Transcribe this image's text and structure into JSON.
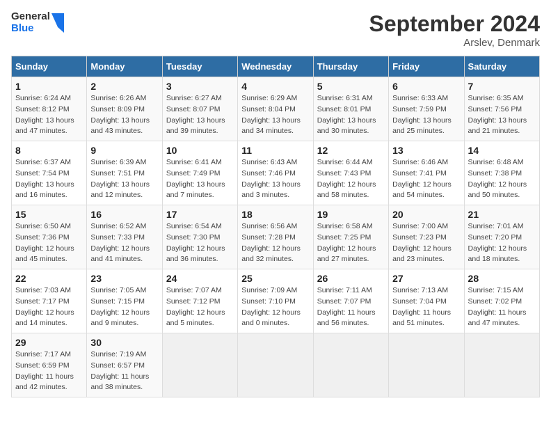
{
  "header": {
    "logo_general": "General",
    "logo_blue": "Blue",
    "title": "September 2024",
    "location": "Arslev, Denmark"
  },
  "weekdays": [
    "Sunday",
    "Monday",
    "Tuesday",
    "Wednesday",
    "Thursday",
    "Friday",
    "Saturday"
  ],
  "weeks": [
    [
      {
        "day": "1",
        "lines": [
          "Sunrise: 6:24 AM",
          "Sunset: 8:12 PM",
          "Daylight: 13 hours",
          "and 47 minutes."
        ]
      },
      {
        "day": "2",
        "lines": [
          "Sunrise: 6:26 AM",
          "Sunset: 8:09 PM",
          "Daylight: 13 hours",
          "and 43 minutes."
        ]
      },
      {
        "day": "3",
        "lines": [
          "Sunrise: 6:27 AM",
          "Sunset: 8:07 PM",
          "Daylight: 13 hours",
          "and 39 minutes."
        ]
      },
      {
        "day": "4",
        "lines": [
          "Sunrise: 6:29 AM",
          "Sunset: 8:04 PM",
          "Daylight: 13 hours",
          "and 34 minutes."
        ]
      },
      {
        "day": "5",
        "lines": [
          "Sunrise: 6:31 AM",
          "Sunset: 8:01 PM",
          "Daylight: 13 hours",
          "and 30 minutes."
        ]
      },
      {
        "day": "6",
        "lines": [
          "Sunrise: 6:33 AM",
          "Sunset: 7:59 PM",
          "Daylight: 13 hours",
          "and 25 minutes."
        ]
      },
      {
        "day": "7",
        "lines": [
          "Sunrise: 6:35 AM",
          "Sunset: 7:56 PM",
          "Daylight: 13 hours",
          "and 21 minutes."
        ]
      }
    ],
    [
      {
        "day": "8",
        "lines": [
          "Sunrise: 6:37 AM",
          "Sunset: 7:54 PM",
          "Daylight: 13 hours",
          "and 16 minutes."
        ]
      },
      {
        "day": "9",
        "lines": [
          "Sunrise: 6:39 AM",
          "Sunset: 7:51 PM",
          "Daylight: 13 hours",
          "and 12 minutes."
        ]
      },
      {
        "day": "10",
        "lines": [
          "Sunrise: 6:41 AM",
          "Sunset: 7:49 PM",
          "Daylight: 13 hours",
          "and 7 minutes."
        ]
      },
      {
        "day": "11",
        "lines": [
          "Sunrise: 6:43 AM",
          "Sunset: 7:46 PM",
          "Daylight: 13 hours",
          "and 3 minutes."
        ]
      },
      {
        "day": "12",
        "lines": [
          "Sunrise: 6:44 AM",
          "Sunset: 7:43 PM",
          "Daylight: 12 hours",
          "and 58 minutes."
        ]
      },
      {
        "day": "13",
        "lines": [
          "Sunrise: 6:46 AM",
          "Sunset: 7:41 PM",
          "Daylight: 12 hours",
          "and 54 minutes."
        ]
      },
      {
        "day": "14",
        "lines": [
          "Sunrise: 6:48 AM",
          "Sunset: 7:38 PM",
          "Daylight: 12 hours",
          "and 50 minutes."
        ]
      }
    ],
    [
      {
        "day": "15",
        "lines": [
          "Sunrise: 6:50 AM",
          "Sunset: 7:36 PM",
          "Daylight: 12 hours",
          "and 45 minutes."
        ]
      },
      {
        "day": "16",
        "lines": [
          "Sunrise: 6:52 AM",
          "Sunset: 7:33 PM",
          "Daylight: 12 hours",
          "and 41 minutes."
        ]
      },
      {
        "day": "17",
        "lines": [
          "Sunrise: 6:54 AM",
          "Sunset: 7:30 PM",
          "Daylight: 12 hours",
          "and 36 minutes."
        ]
      },
      {
        "day": "18",
        "lines": [
          "Sunrise: 6:56 AM",
          "Sunset: 7:28 PM",
          "Daylight: 12 hours",
          "and 32 minutes."
        ]
      },
      {
        "day": "19",
        "lines": [
          "Sunrise: 6:58 AM",
          "Sunset: 7:25 PM",
          "Daylight: 12 hours",
          "and 27 minutes."
        ]
      },
      {
        "day": "20",
        "lines": [
          "Sunrise: 7:00 AM",
          "Sunset: 7:23 PM",
          "Daylight: 12 hours",
          "and 23 minutes."
        ]
      },
      {
        "day": "21",
        "lines": [
          "Sunrise: 7:01 AM",
          "Sunset: 7:20 PM",
          "Daylight: 12 hours",
          "and 18 minutes."
        ]
      }
    ],
    [
      {
        "day": "22",
        "lines": [
          "Sunrise: 7:03 AM",
          "Sunset: 7:17 PM",
          "Daylight: 12 hours",
          "and 14 minutes."
        ]
      },
      {
        "day": "23",
        "lines": [
          "Sunrise: 7:05 AM",
          "Sunset: 7:15 PM",
          "Daylight: 12 hours",
          "and 9 minutes."
        ]
      },
      {
        "day": "24",
        "lines": [
          "Sunrise: 7:07 AM",
          "Sunset: 7:12 PM",
          "Daylight: 12 hours",
          "and 5 minutes."
        ]
      },
      {
        "day": "25",
        "lines": [
          "Sunrise: 7:09 AM",
          "Sunset: 7:10 PM",
          "Daylight: 12 hours",
          "and 0 minutes."
        ]
      },
      {
        "day": "26",
        "lines": [
          "Sunrise: 7:11 AM",
          "Sunset: 7:07 PM",
          "Daylight: 11 hours",
          "and 56 minutes."
        ]
      },
      {
        "day": "27",
        "lines": [
          "Sunrise: 7:13 AM",
          "Sunset: 7:04 PM",
          "Daylight: 11 hours",
          "and 51 minutes."
        ]
      },
      {
        "day": "28",
        "lines": [
          "Sunrise: 7:15 AM",
          "Sunset: 7:02 PM",
          "Daylight: 11 hours",
          "and 47 minutes."
        ]
      }
    ],
    [
      {
        "day": "29",
        "lines": [
          "Sunrise: 7:17 AM",
          "Sunset: 6:59 PM",
          "Daylight: 11 hours",
          "and 42 minutes."
        ]
      },
      {
        "day": "30",
        "lines": [
          "Sunrise: 7:19 AM",
          "Sunset: 6:57 PM",
          "Daylight: 11 hours",
          "and 38 minutes."
        ]
      },
      {
        "day": "",
        "lines": []
      },
      {
        "day": "",
        "lines": []
      },
      {
        "day": "",
        "lines": []
      },
      {
        "day": "",
        "lines": []
      },
      {
        "day": "",
        "lines": []
      }
    ]
  ]
}
